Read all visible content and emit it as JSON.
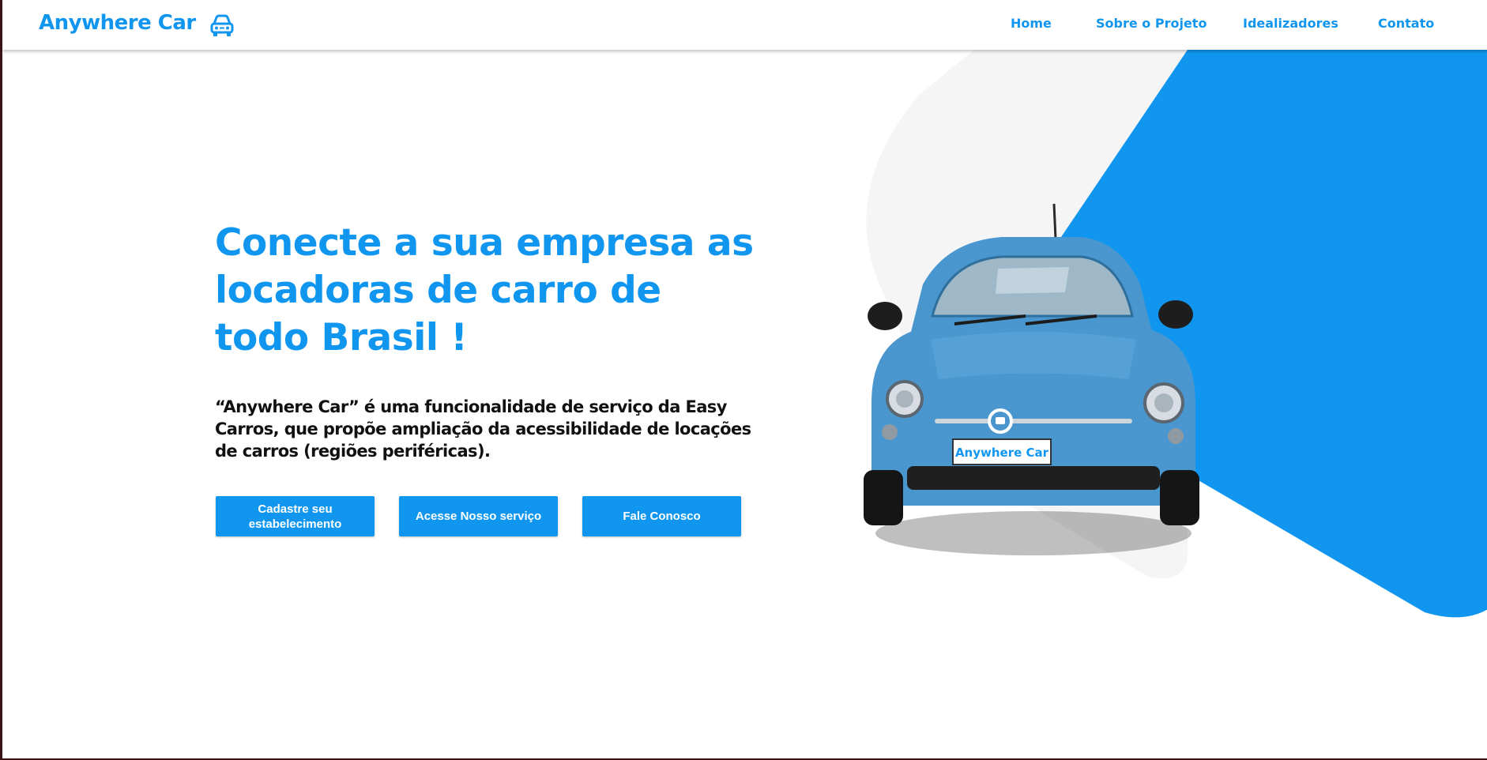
{
  "header": {
    "brand": "Anywhere Car",
    "brand_icon": "car-icon",
    "nav": [
      {
        "label": "Home"
      },
      {
        "label": "Sobre o Projeto"
      },
      {
        "label": "Idealizadores"
      },
      {
        "label": "Contato"
      }
    ]
  },
  "hero": {
    "headline": "Conecte a sua empresa as locadoras de carro de todo Brasil !",
    "description": "“Anywhere Car” é uma funcionalidade de serviço da Easy Carros, que propõe ampliação da acessibilidade de locações de carros (regiões periféricas).",
    "buttons": [
      {
        "label": "Cadastre seu estabelecimento"
      },
      {
        "label": "Acesse Nosso serviço"
      },
      {
        "label": "Fale Conosco"
      }
    ],
    "car_plate": "Anywhere Car"
  },
  "colors": {
    "accent": "#1196f0",
    "text_dark": "#111111",
    "shape_light": "#f5f5f6",
    "car_body": "#4a97cf"
  }
}
